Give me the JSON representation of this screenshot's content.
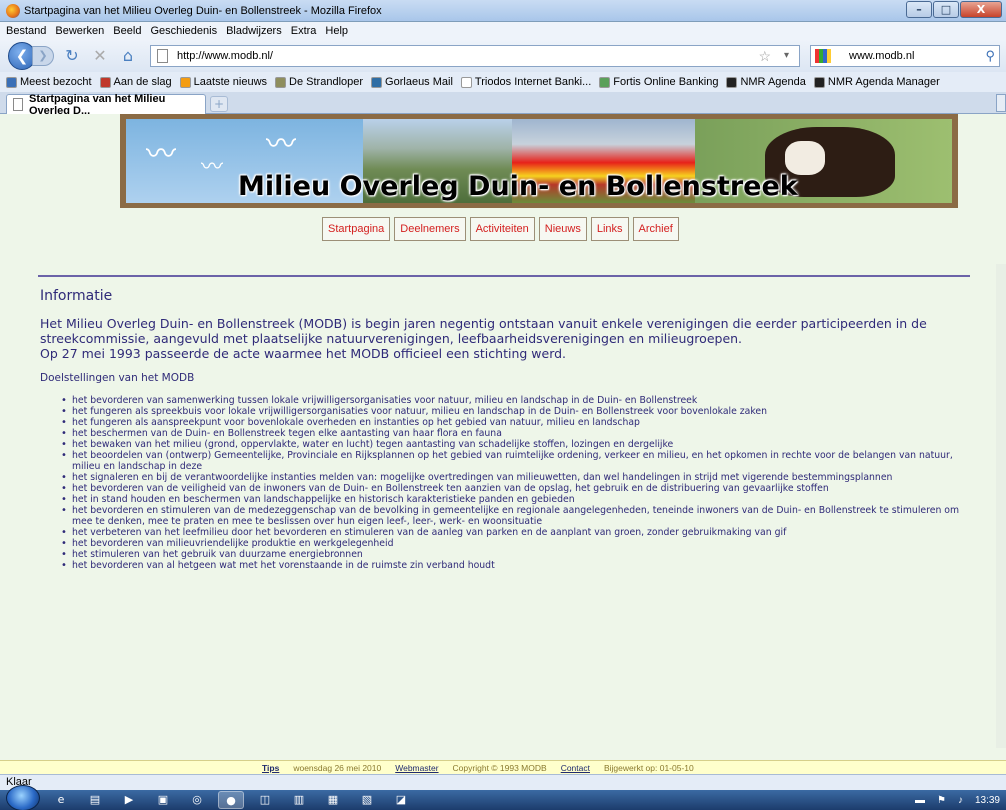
{
  "window": {
    "title": "Startpagina van het Milieu Overleg Duin- en Bollenstreek - Mozilla Firefox",
    "minimize": "–",
    "maximize": "□",
    "close": "X"
  },
  "menu": [
    "Bestand",
    "Bewerken",
    "Beeld",
    "Geschiedenis",
    "Bladwijzers",
    "Extra",
    "Help"
  ],
  "nav": {
    "url": "http://www.modb.nl/",
    "search_value": "www.modb.nl"
  },
  "bookmarks": [
    {
      "label": "Meest bezocht",
      "color": "#3a6fb6"
    },
    {
      "label": "Aan de slag",
      "color": "#c0392b"
    },
    {
      "label": "Laatste nieuws",
      "color": "#f39c12"
    },
    {
      "label": "De Strandloper",
      "color": "#8e8e5e"
    },
    {
      "label": "Gorlaeus Mail",
      "color": "#2e6da4"
    },
    {
      "label": "Triodos Internet Banki...",
      "color": "#ffffff"
    },
    {
      "label": "Fortis Online Banking",
      "color": "#5aa05a"
    },
    {
      "label": "NMR Agenda",
      "color": "#222222"
    },
    {
      "label": "NMR Agenda Manager",
      "color": "#222222"
    }
  ],
  "tab": {
    "title": "Startpagina van het Milieu Overleg D...",
    "new_tab": "+"
  },
  "banner": {
    "title": "Milieu Overleg Duin- en Bollenstreek"
  },
  "site_nav": [
    "Startpagina",
    "Deelnemers",
    "Activiteiten",
    "Nieuws",
    "Links",
    "Archief"
  ],
  "content": {
    "heading": "Informatie",
    "para1": "Het Milieu Overleg Duin- en Bollenstreek (MODB) is begin jaren negentig ontstaan vanuit enkele verenigingen die eerder participeerden in de streekcommissie, aangevuld met plaatselijke natuurverenigingen, leefbaarheidsverenigingen en milieugroepen.",
    "para2": "Op 27 mei 1993 passeerde de acte waarmee het MODB officieel een stichting werd.",
    "doel_heading": "Doelstellingen van het MODB",
    "items": [
      "het bevorderen van samenwerking tussen lokale vrijwilligersorganisaties voor natuur, milieu en landschap in de Duin- en Bollenstreek",
      "het fungeren als spreekbuis voor lokale vrijwilligersorganisaties voor natuur, milieu en landschap in de Duin- en Bollenstreek voor bovenlokale zaken",
      "het fungeren als aanspreekpunt voor bovenlokale overheden en instanties op het gebied van natuur, milieu en landschap",
      "het beschermen van de Duin- en Bollenstreek tegen elke aantasting van haar flora en fauna",
      "het bewaken van het milieu (grond, oppervlakte, water en lucht) tegen aantasting van schadelijke stoffen, lozingen en dergelijke",
      "het beoordelen van (ontwerp) Gemeentelijke, Provinciale en Rijksplannen op het gebied van ruimtelijke ordening, verkeer en milieu, en het opkomen in rechte voor de belangen van natuur, milieu en landschap in deze",
      "het signaleren en bij de verantwoordelijke instanties melden van: mogelijke overtredingen van milieuwetten, dan wel handelingen in strijd met vigerende bestemmingsplannen",
      "het bevorderen van de veiligheid van de inwoners van de Duin- en Bollenstreek ten aanzien van de opslag, het gebruik en de distribuering van gevaarlijke stoffen",
      "het in stand houden en beschermen van landschappelijke en historisch karakteristieke panden en gebieden",
      "het bevorderen en stimuleren van de medezeggenschap van de bevolking in gemeentelijke en regionale aangelegenheden, teneinde inwoners van de Duin- en Bollenstreek te stimuleren om mee te denken, mee te praten en mee te beslissen over hun eigen leef-, leer-, werk- en woonsituatie",
      "het verbeteren van het leefmilieu door het bevorderen en stimuleren van de aanleg van parken en de aanplant van groen, zonder gebruikmaking van gif",
      "het bevorderen van milieuvriendelijke produktie en werkgelegenheid",
      "het stimuleren van het gebruik van duurzame energiebronnen",
      "het bevorderen van al hetgeen wat met het vorenstaande in de ruimste zin verband houdt"
    ]
  },
  "footer": {
    "tips": "Tips",
    "date": "woensdag 26 mei 2010",
    "webmaster": "Webmaster",
    "copyright": "Copyright © 1993 MODB",
    "contact": "Contact",
    "updated": "Bijgewerkt op: 01-05-10"
  },
  "status": "Klaar",
  "taskbar": {
    "clock": "13:39"
  }
}
